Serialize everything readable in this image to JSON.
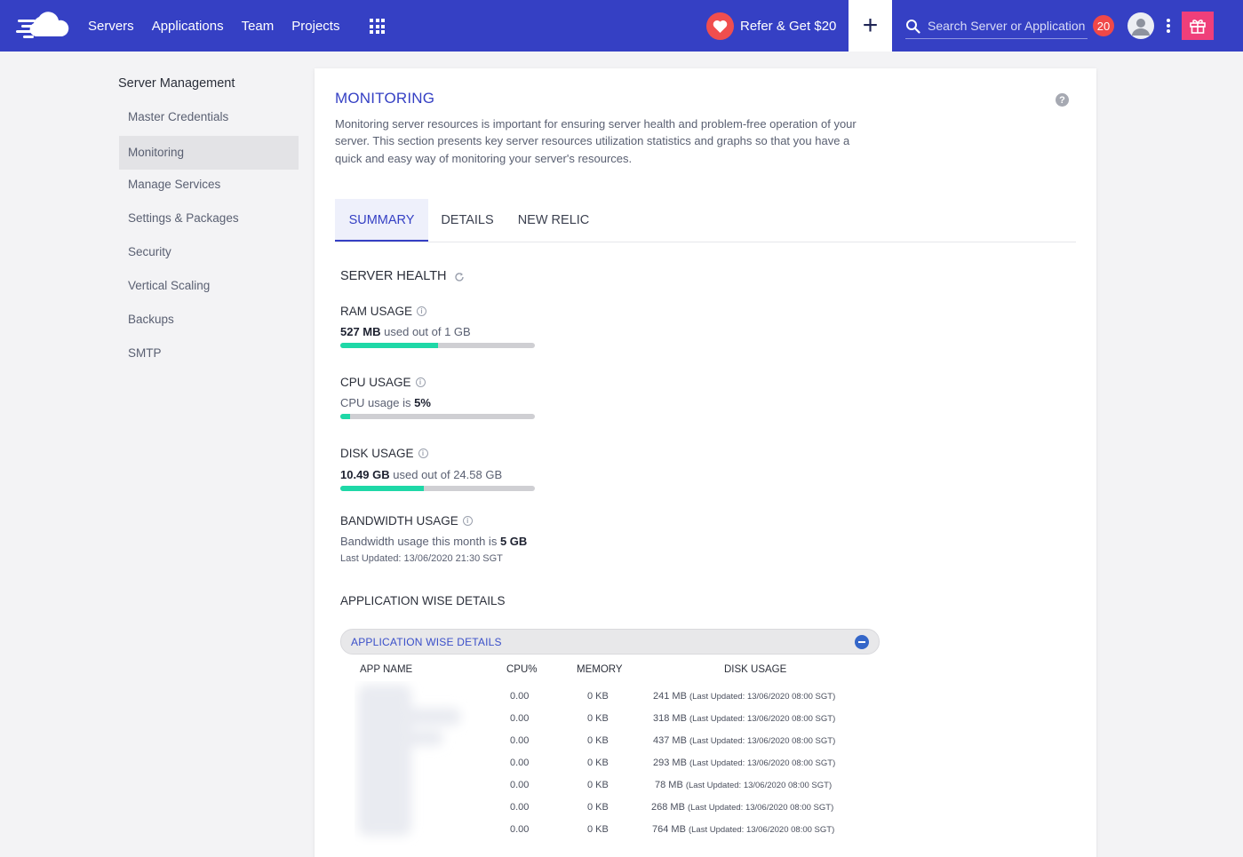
{
  "topbar": {
    "nav": [
      "Servers",
      "Applications",
      "Team",
      "Projects"
    ],
    "refer_label": "Refer & Get $20",
    "search_placeholder": "Search Server or Application",
    "notification_count": "20",
    "bg_color": "#3540c4",
    "icons": [
      "cloud-logo-icon",
      "apps-grid-icon",
      "heart-icon",
      "plus-icon",
      "search-icon",
      "avatar-icon",
      "kebab-menu-icon",
      "gift-icon"
    ]
  },
  "sidebar": {
    "title": "Server Management",
    "items": [
      "Master Credentials",
      "Monitoring",
      "Manage Services",
      "Settings & Packages",
      "Security",
      "Vertical Scaling",
      "Backups",
      "SMTP"
    ],
    "active": "Monitoring"
  },
  "main": {
    "title": "MONITORING",
    "description": "Monitoring server resources is important for ensuring server health and problem-free operation of your server. This section presents key server resources utilization statistics and graphs so that you have a quick and easy way of monitoring your server's resources.",
    "tabs": [
      "SUMMARY",
      "DETAILS",
      "NEW RELIC"
    ],
    "active_tab": "SUMMARY",
    "server_health": {
      "title": "SERVER HEALTH",
      "ram": {
        "title": "RAM USAGE",
        "value": "527 MB",
        "text": " used out of 1 GB",
        "percent": 50
      },
      "cpu": {
        "title": "CPU USAGE",
        "prefix": "CPU usage is ",
        "value": "5%",
        "percent": 5
      },
      "disk": {
        "title": "DISK USAGE",
        "value": "10.49 GB",
        "text": " used out of 24.58 GB",
        "percent": 43
      },
      "bandwidth": {
        "title": "BANDWIDTH USAGE",
        "prefix": "Bandwidth usage this month is ",
        "value": "5 GB"
      },
      "last_updated": "Last Updated: 13/06/2020 21:30 SGT"
    },
    "app_details": {
      "section_title": "APPLICATION WISE DETAILS",
      "accordion_title": "APPLICATION WISE DETAILS",
      "columns": [
        "APP NAME",
        "CPU%",
        "MEMORY",
        "DISK USAGE"
      ],
      "rows": [
        {
          "cpu": "0.00",
          "memory": "0 KB",
          "disk": "241 MB",
          "updated": "(Last Updated: 13/06/2020 08:00 SGT)"
        },
        {
          "cpu": "0.00",
          "memory": "0 KB",
          "disk": "318 MB",
          "updated": "(Last Updated: 13/06/2020 08:00 SGT)"
        },
        {
          "cpu": "0.00",
          "memory": "0 KB",
          "disk": "437 MB",
          "updated": "(Last Updated: 13/06/2020 08:00 SGT)"
        },
        {
          "cpu": "0.00",
          "memory": "0 KB",
          "disk": "293 MB",
          "updated": "(Last Updated: 13/06/2020 08:00 SGT)"
        },
        {
          "cpu": "0.00",
          "memory": "0 KB",
          "disk": "78 MB",
          "updated": "(Last Updated: 13/06/2020 08:00 SGT)"
        },
        {
          "cpu": "0.00",
          "memory": "0 KB",
          "disk": "268 MB",
          "updated": "(Last Updated: 13/06/2020 08:00 SGT)"
        },
        {
          "cpu": "0.00",
          "memory": "0 KB",
          "disk": "764 MB",
          "updated": "(Last Updated: 13/06/2020 08:00 SGT)"
        }
      ]
    },
    "accent_color": "#3540c4",
    "progress_color": "#1ed8a7"
  }
}
